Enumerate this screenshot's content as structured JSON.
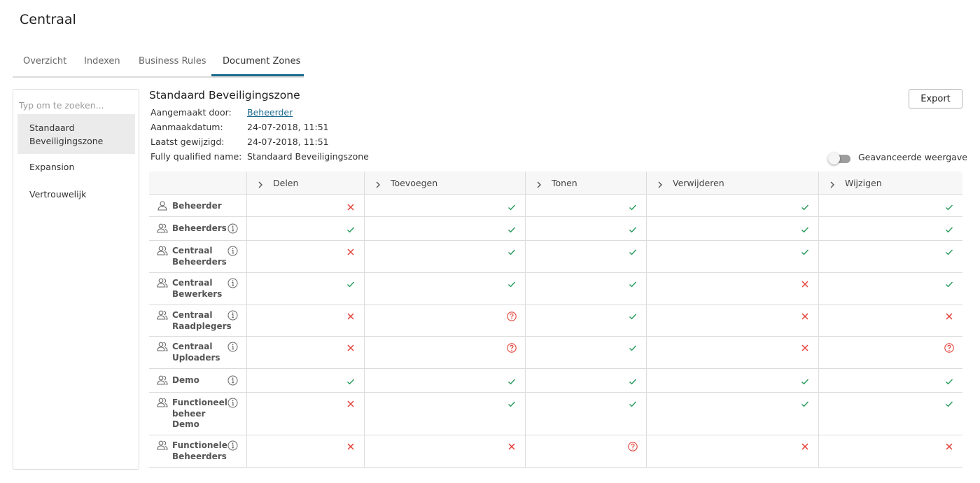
{
  "app": {
    "title": "Centraal"
  },
  "tabs": [
    "Overzicht",
    "Indexen",
    "Business Rules",
    "Document Zones"
  ],
  "sidebar": {
    "search_placeholder": "Typ om te zoeken...",
    "items": [
      {
        "label": "Standaard Beveiligingszone",
        "active": true
      },
      {
        "label": "Expansion",
        "active": false
      },
      {
        "label": "Vertrouwelijk",
        "active": false
      }
    ]
  },
  "zone": {
    "title": "Standaard Beveiligingszone",
    "created_by_label": "Aangemaakt door:",
    "created_by": "Beheerder",
    "created_date_label": "Aanmaakdatum:",
    "created_date": "24-07-2018, 11:51",
    "modified_label": "Laatst gewijzigd:",
    "modified": "24-07-2018, 11:51",
    "fqn_label": "Fully qualified name:",
    "fqn": "Standaard Beveiligingszone"
  },
  "actions": {
    "export_label": "Export"
  },
  "advanced_toggle": {
    "label": "Geavanceerde weergave",
    "on": false
  },
  "colors": {
    "check": "#2e9e61",
    "cross": "#e3423a",
    "unknown": "#e3423a",
    "accent": "#1b6a8e"
  },
  "permissions": {
    "columns": [
      "Delen",
      "Toevoegen",
      "Tonen",
      "Verwijderen",
      "Wijzigen"
    ],
    "rows": [
      {
        "name": "Beheerder",
        "icon": "user-icon",
        "info": false,
        "values": [
          "cross",
          "check",
          "check",
          "check",
          "check"
        ]
      },
      {
        "name": "Beheerders",
        "icon": "group-icon",
        "info": true,
        "values": [
          "check",
          "check",
          "check",
          "check",
          "check"
        ]
      },
      {
        "name": "Centraal Beheerders",
        "icon": "group-icon",
        "info": true,
        "values": [
          "cross",
          "check",
          "check",
          "check",
          "check"
        ]
      },
      {
        "name": "Centraal Bewerkers",
        "icon": "group-icon",
        "info": true,
        "values": [
          "check",
          "check",
          "check",
          "cross",
          "check"
        ]
      },
      {
        "name": "Centraal Raadplegers",
        "icon": "group-icon",
        "info": true,
        "values": [
          "cross",
          "unknown",
          "check",
          "cross",
          "cross"
        ]
      },
      {
        "name": "Centraal Uploaders",
        "icon": "group-icon",
        "info": true,
        "values": [
          "cross",
          "unknown",
          "check",
          "cross",
          "unknown"
        ]
      },
      {
        "name": "Demo",
        "icon": "group-icon",
        "info": true,
        "values": [
          "check",
          "check",
          "check",
          "check",
          "check"
        ]
      },
      {
        "name": "Functioneel beheer Demo",
        "icon": "group-icon",
        "info": true,
        "values": [
          "cross",
          "check",
          "check",
          "check",
          "check"
        ]
      },
      {
        "name": "Functionele Beheerders",
        "icon": "group-icon",
        "info": true,
        "values": [
          "cross",
          "cross",
          "unknown",
          "cross",
          "cross"
        ]
      }
    ]
  }
}
